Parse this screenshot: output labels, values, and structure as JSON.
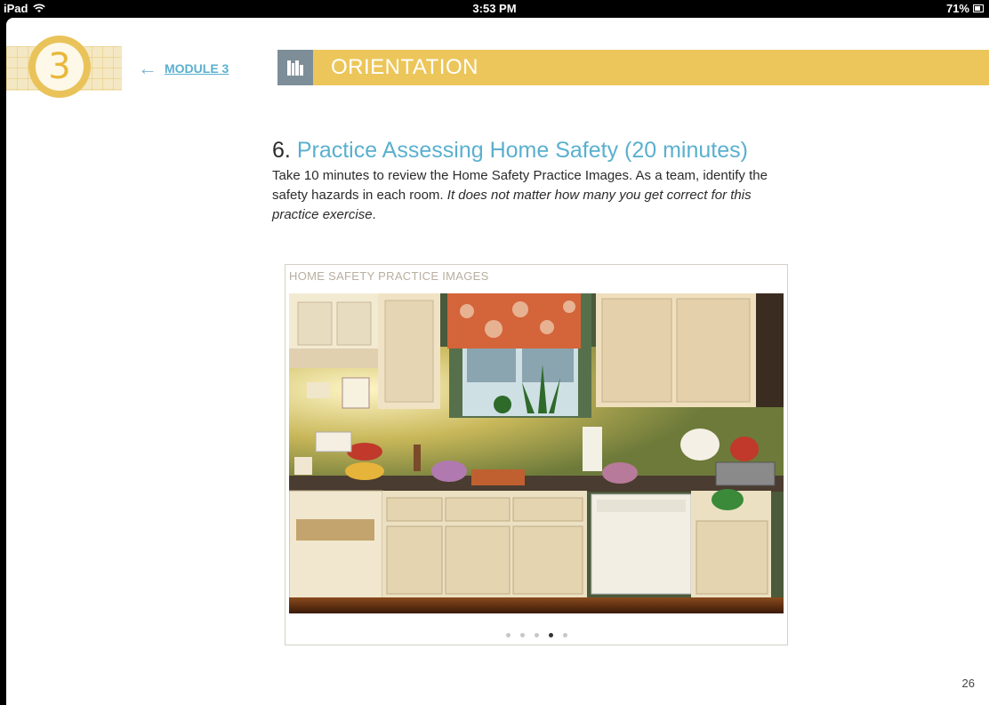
{
  "status_bar": {
    "device": "iPad",
    "time": "3:53 PM",
    "battery": "71%"
  },
  "module": {
    "number": "3",
    "back_label": "MODULE 3"
  },
  "section": {
    "title": "ORIENTATION",
    "icon": "book-icon"
  },
  "content": {
    "heading_number": "6.",
    "heading_text": "Practice Assessing Home Safety (20 minutes)",
    "body_plain": "Take 10 minutes to review the Home Safety Practice Images. As a team, identify the safety hazards in each room.",
    "body_italic": "It does not matter how many you get correct for this practice exercise",
    "body_end": "."
  },
  "gallery": {
    "caption": "HOME SAFETY PRACTICE IMAGES",
    "page_count": 5,
    "active_page": 4
  },
  "page_number": "26",
  "colors": {
    "accent_blue": "#5ab0cf",
    "banner_yellow": "#ecc65a",
    "icon_gray": "#7d8e98"
  }
}
